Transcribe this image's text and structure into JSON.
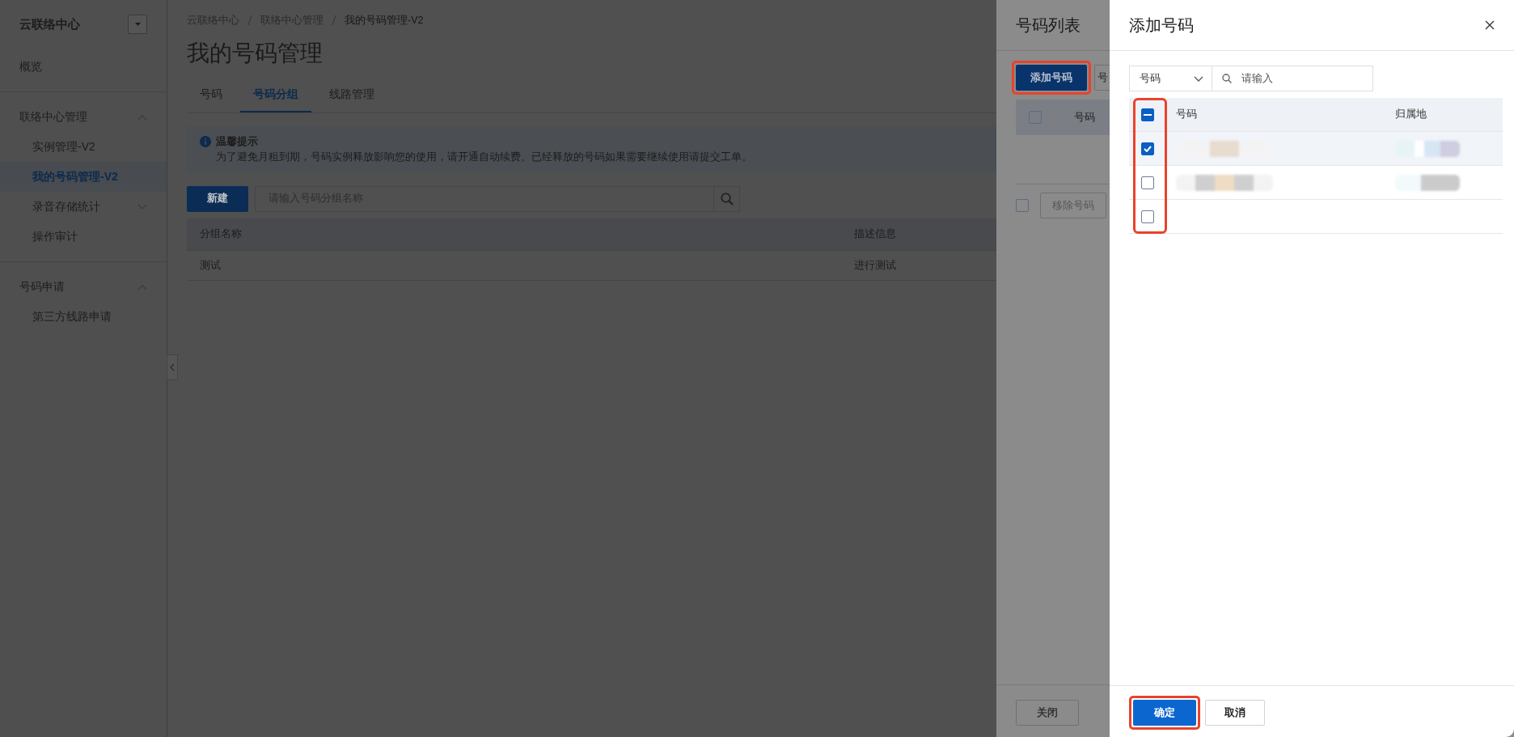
{
  "sidebar": {
    "title": "云联络中心",
    "sections": [
      {
        "items": [
          {
            "label": "概览",
            "selected": false
          }
        ]
      },
      {
        "heading": "联络中心管理",
        "expanded": true,
        "items": [
          {
            "label": "实例管理-V2",
            "selected": false
          },
          {
            "label": "我的号码管理-V2",
            "selected": true
          },
          {
            "label": "录音存储统计",
            "selected": false,
            "expanded": false
          },
          {
            "label": "操作审计",
            "selected": false
          }
        ]
      },
      {
        "heading": "号码申请",
        "expanded": true,
        "items": [
          {
            "label": "第三方线路申请",
            "selected": false
          }
        ]
      }
    ]
  },
  "main": {
    "breadcrumb": [
      "云联络中心",
      "联络中心管理",
      "我的号码管理-V2"
    ],
    "title": "我的号码管理",
    "tabs": [
      {
        "label": "号码",
        "selected": false
      },
      {
        "label": "号码分组",
        "selected": true
      },
      {
        "label": "线路管理",
        "selected": false
      }
    ],
    "alert": {
      "title": "温馨提示",
      "text": "为了避免月租到期，号码实例释放影响您的使用，请开通自动续费。已经释放的号码如果需要继续使用请提交工单。"
    },
    "toolbar": {
      "button": "新建",
      "placeholder": "请输入号码分组名称"
    },
    "table": {
      "columns": [
        "分组名称",
        "描述信息"
      ],
      "rows": [
        [
          "测试",
          "进行测试"
        ]
      ]
    }
  },
  "list_drawer": {
    "title": "号码列表",
    "buttons": [
      {
        "label": "添加号码",
        "kind": "primary",
        "highlighted": true
      },
      {
        "label": "号",
        "kind": "default",
        "highlighted": false
      }
    ],
    "table": {
      "checked": false,
      "columns": [
        "号码"
      ]
    },
    "bulk": {
      "checked": false,
      "button": "移除号码"
    },
    "close_button": "关闭"
  },
  "add_drawer": {
    "title": "添加号码",
    "filter": {
      "field": "号码",
      "placeholder": "请输入"
    },
    "table": {
      "columns": [
        "号码",
        "归属地"
      ],
      "header_indeterminate": true,
      "checkbox_highlighted": true,
      "rows": [
        {
          "checked": true,
          "selected": true,
          "redacted": true
        },
        {
          "checked": false,
          "selected": false,
          "redacted": true
        },
        {
          "checked": false,
          "selected": false,
          "redacted": false
        }
      ]
    },
    "buttons": [
      {
        "label": "确定",
        "kind": "primary",
        "highlighted": true
      },
      {
        "label": "取消",
        "kind": "default",
        "highlighted": false
      }
    ]
  }
}
